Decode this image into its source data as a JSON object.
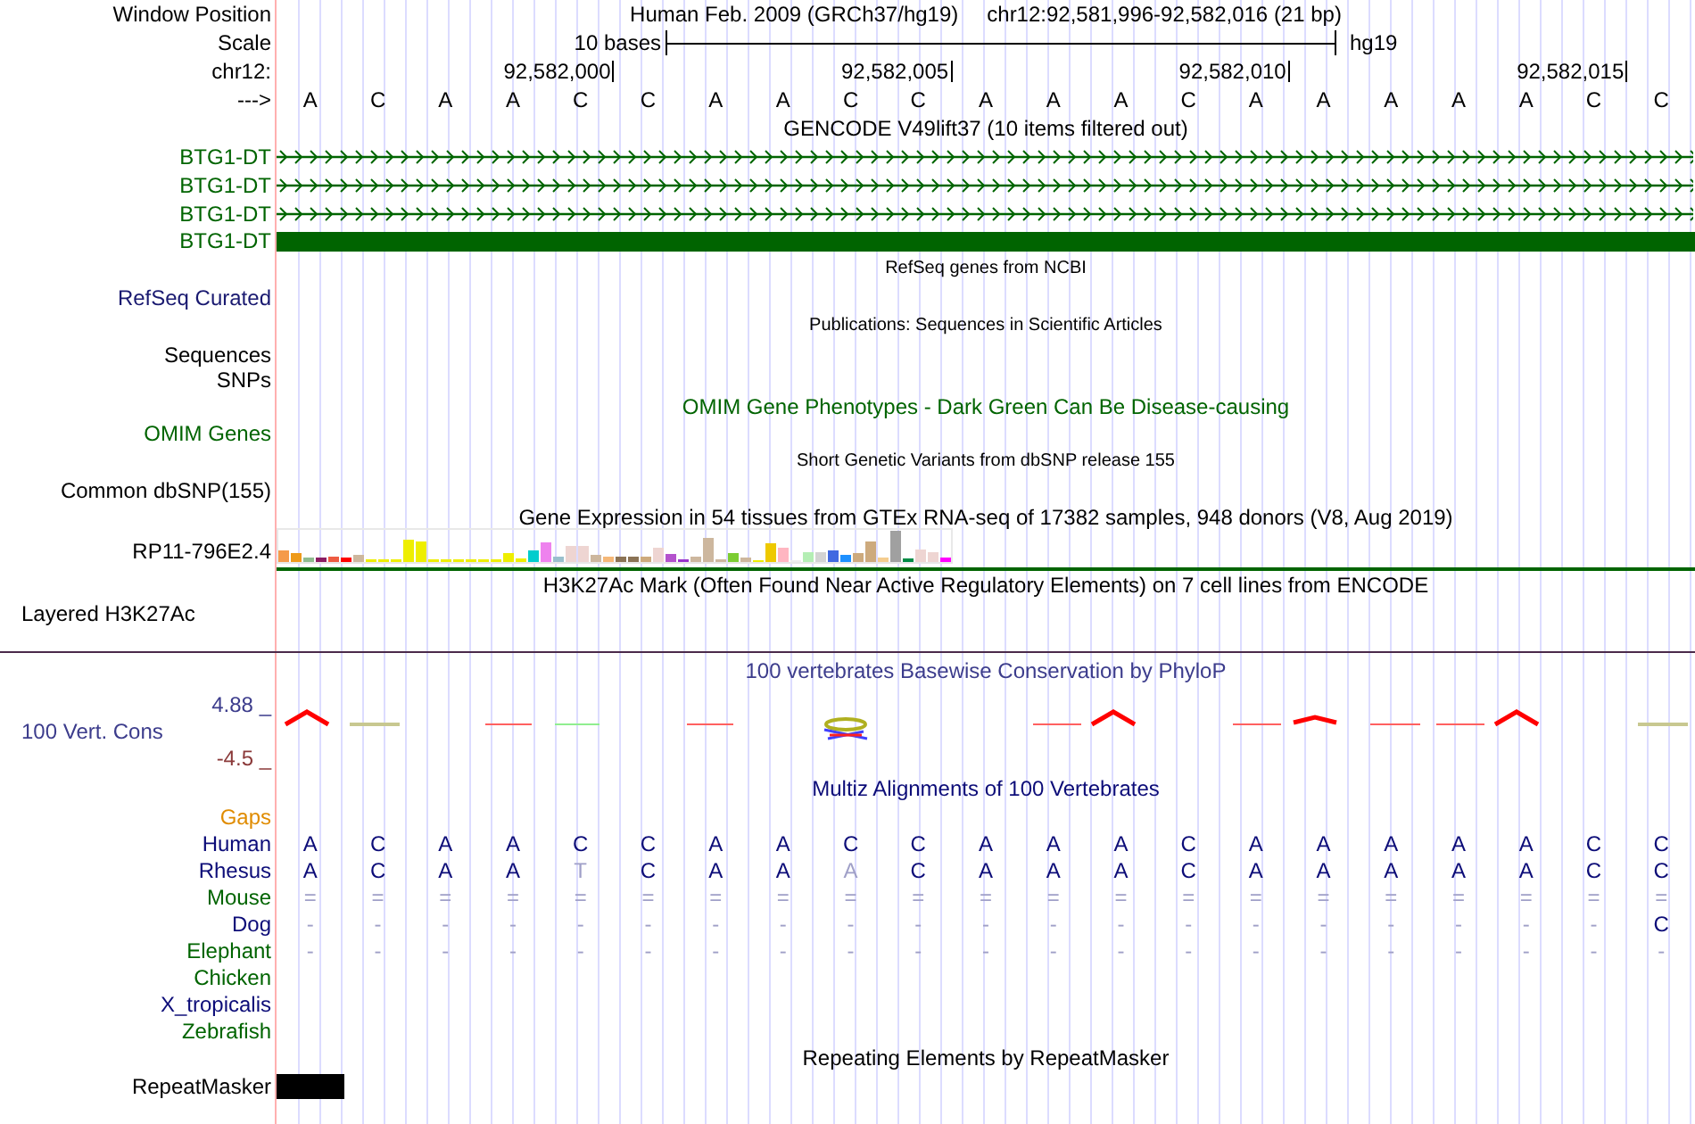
{
  "header": {
    "label": "Window Position",
    "assembly": "Human Feb. 2009 (GRCh37/hg19)",
    "range": "chr12:92,581,996-92,582,016 (21 bp)"
  },
  "scale": {
    "label": "Scale",
    "length": "10 bases",
    "assembly": "hg19"
  },
  "coordinates": {
    "label": "chr12:",
    "ticks": [
      "92,582,000",
      "92,582,005",
      "92,582,010",
      "92,582,015"
    ]
  },
  "sequence": {
    "label": "--->",
    "bases": [
      "A",
      "C",
      "A",
      "A",
      "C",
      "C",
      "A",
      "A",
      "C",
      "C",
      "A",
      "A",
      "A",
      "C",
      "A",
      "A",
      "A",
      "A",
      "A",
      "C",
      "C"
    ]
  },
  "tracks": [
    {
      "kind": "standard",
      "title": "GENCODE V49lift37 (10 items filtered out)",
      "color": "#000000",
      "rows": [
        {
          "label": "BTG1-DT",
          "color": "#006400",
          "kind": "intron"
        },
        {
          "label": "BTG1-DT",
          "color": "#006400",
          "kind": "intron"
        },
        {
          "label": "BTG1-DT",
          "color": "#006400",
          "kind": "intron"
        },
        {
          "label": "BTG1-DT",
          "color": "#006400",
          "kind": "exon"
        }
      ]
    },
    {
      "kind": "compact",
      "title": "RefSeq genes from NCBI",
      "color": "#000000",
      "rows": [
        {
          "label": "RefSeq Curated",
          "color": "#191970",
          "kind": "empty"
        }
      ]
    },
    {
      "kind": "compact",
      "title": "Publications: Sequences in Scientific Articles",
      "color": "#000000",
      "rows": [
        {
          "label": "Sequences",
          "color": "#000000",
          "kind": "empty"
        },
        {
          "label": "SNPs",
          "color": "#000000",
          "kind": "empty"
        }
      ]
    },
    {
      "kind": "standard",
      "title": "OMIM Gene Phenotypes - Dark Green Can Be Disease-causing",
      "color": "#006400",
      "rows": [
        {
          "label": "OMIM Genes",
          "color": "#006400",
          "kind": "empty"
        }
      ]
    },
    {
      "kind": "compact",
      "title": "Short Genetic Variants from dbSNP release 155",
      "color": "#000000",
      "rows": [
        {
          "label": "Common dbSNP(155)",
          "color": "#000000",
          "kind": "empty"
        }
      ]
    },
    {
      "kind": "standard",
      "title": "Gene Expression in 54 tissues from GTEx RNA-seq of 17382 samples, 948 donors (V8, Aug 2019)",
      "color": "#000000",
      "rows": [
        {
          "label": "RP11-796E2.4",
          "color": "#000000",
          "kind": "bars"
        }
      ]
    },
    {
      "kind": "standard",
      "title": "H3K27Ac Mark (Often Found Near Active Regulatory Elements) on 7 cell lines from ENCODE",
      "color": "#000000",
      "rows": [
        {
          "label": "Layered H3K27Ac",
          "color": "#000000",
          "kind": "layered"
        }
      ]
    },
    {
      "kind": "conservation",
      "title": "100 vertebrates Basewise Conservation by PhyloP",
      "color": "#3c3c8c",
      "max": "4.88 _",
      "min": "-4.5 _",
      "rows": [
        {
          "label": "100 Vert. Cons",
          "color": "#3c3c8c",
          "kind": "wiggle"
        }
      ]
    },
    {
      "kind": "standard",
      "title": "Multiz Alignments of 100 Vertebrates",
      "color": "#0c0c78",
      "rows": [
        {
          "label": "Gaps",
          "color": "#e08c00",
          "kind": "bases"
        },
        {
          "label": "Human",
          "color": "#0c0c78",
          "kind": "bases",
          "bases": [
            "A",
            "C",
            "A",
            "A",
            "C",
            "C",
            "A",
            "A",
            "C",
            "C",
            "A",
            "A",
            "A",
            "C",
            "A",
            "A",
            "A",
            "A",
            "A",
            "C",
            "C"
          ]
        },
        {
          "label": "Rhesus",
          "color": "#0c0c78",
          "kind": "bases",
          "bases": [
            "A",
            "C",
            "A",
            "A",
            "T",
            "C",
            "A",
            "A",
            "A",
            "C",
            "A",
            "A",
            "A",
            "C",
            "A",
            "A",
            "A",
            "A",
            "A",
            "C",
            "C"
          ]
        },
        {
          "label": "Mouse",
          "color": "#006400",
          "kind": "bases",
          "bases": [
            "=",
            "=",
            "=",
            "=",
            "=",
            "=",
            "=",
            "=",
            "=",
            "=",
            "=",
            "=",
            "=",
            "=",
            "=",
            "=",
            "=",
            "=",
            "=",
            "=",
            "="
          ]
        },
        {
          "label": "Dog",
          "color": "#0c0c78",
          "kind": "bases",
          "bases": [
            "-",
            "-",
            "-",
            "-",
            "-",
            "-",
            "-",
            "-",
            "-",
            "-",
            "-",
            "-",
            "-",
            "-",
            "-",
            "-",
            "-",
            "-",
            "-",
            "-",
            "C"
          ]
        },
        {
          "label": "Elephant",
          "color": "#006400",
          "kind": "bases",
          "bases": [
            "-",
            "-",
            "-",
            "-",
            "-",
            "-",
            "-",
            "-",
            "-",
            "-",
            "-",
            "-",
            "-",
            "-",
            "-",
            "-",
            "-",
            "-",
            "-",
            "-",
            "-"
          ]
        },
        {
          "label": "Chicken",
          "color": "#006400",
          "kind": "bases"
        },
        {
          "label": "X_tropicalis",
          "color": "#0c0c78",
          "kind": "bases"
        },
        {
          "label": "Zebrafish",
          "color": "#006400",
          "kind": "bases"
        }
      ]
    },
    {
      "kind": "standard",
      "title": "Repeating Elements by RepeatMasker",
      "color": "#000000",
      "rows": [
        {
          "label": "RepeatMasker",
          "color": "#000000",
          "kind": "block"
        }
      ]
    }
  ]
}
